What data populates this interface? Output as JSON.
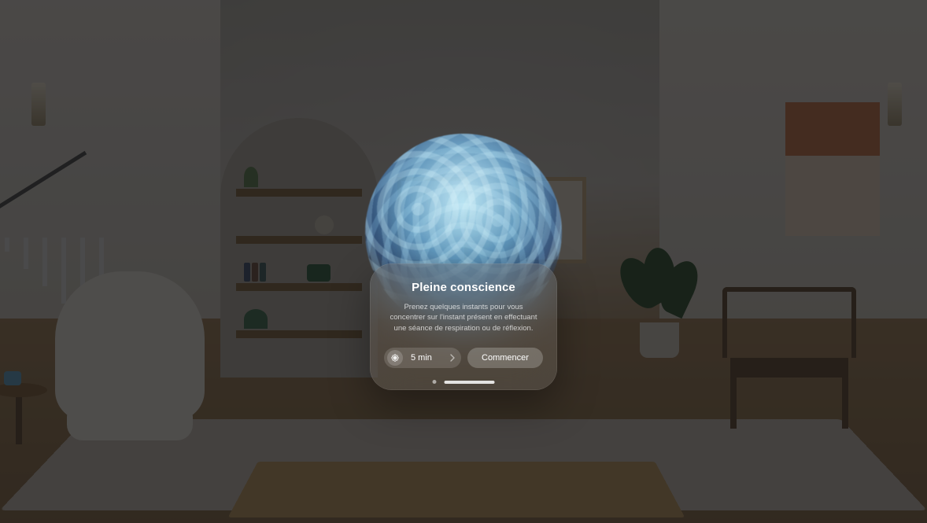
{
  "panel": {
    "title": "Pleine conscience",
    "description": "Prenez quelques instants pour vous concentrer sur l'instant présent en effectuant une séance de respiration ou de réflexion.",
    "duration_label": "5 min",
    "start_label": "Commencer"
  },
  "icons": {
    "mode": "breathe-flower-icon",
    "chevron": "chevron-right-icon"
  },
  "pagination": {
    "index": 1,
    "count": 2
  }
}
